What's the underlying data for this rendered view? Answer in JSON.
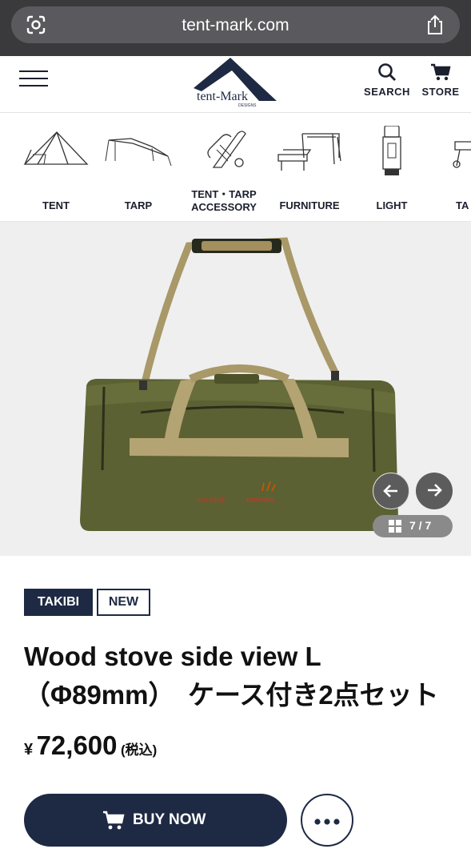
{
  "browser": {
    "url": "tent-mark.com"
  },
  "header": {
    "logo_text": "tent-Mark",
    "logo_sub": "DESIGNS",
    "search_label": "SEARCH",
    "store_label": "STORE"
  },
  "categories": [
    {
      "label_line1": "TENT",
      "label_line2": ""
    },
    {
      "label_line1": "TARP",
      "label_line2": ""
    },
    {
      "label_line1": "TENT・TARP",
      "label_line2": "ACCESSORY"
    },
    {
      "label_line1": "FURNITURE",
      "label_line2": ""
    },
    {
      "label_line1": "LIGHT",
      "label_line2": ""
    },
    {
      "label_line1": "TA",
      "label_line2": ""
    }
  ],
  "gallery": {
    "counter": "7 / 7",
    "image_progress": {
      "current": 7,
      "total": 7
    }
  },
  "product": {
    "tags": [
      "TAKIBI",
      "NEW"
    ],
    "title_line1": "Wood stove side view L",
    "title_line2": "（Φ89mm）　ケース付き2点セット",
    "price_currency": "¥",
    "price_amount": "72,600",
    "price_tax": "(税込)"
  },
  "actions": {
    "buy_label": "BUY NOW"
  },
  "colors": {
    "navy": "#1e2a44",
    "bag_olive": "#5b6132",
    "strap_tan": "#b4a373"
  }
}
